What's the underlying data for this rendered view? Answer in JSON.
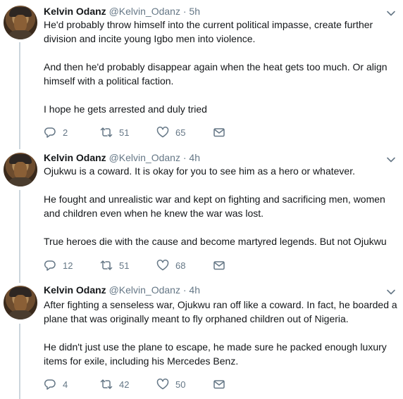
{
  "tweets": [
    {
      "name": "Kelvin Odanz",
      "handle": "@Kelvin_Odanz",
      "time": "· 5h",
      "paragraphs": [
        "He'd probably throw himself into the current political impasse, create further division and incite young Igbo men into violence.",
        "And then he'd probably disappear again when the heat gets too much. Or align himself with a political faction.",
        "I hope he gets arrested and duly tried"
      ],
      "replies": "2",
      "retweets": "51",
      "likes": "65"
    },
    {
      "name": "Kelvin Odanz",
      "handle": "@Kelvin_Odanz",
      "time": "· 4h",
      "paragraphs": [
        "Ojukwu is a coward. It is okay for you to see him as a hero or whatever.",
        "He fought and unrealistic war and kept on fighting and sacrificing men, women and children even when he knew the war was lost.",
        "True heroes die with the cause and become martyred legends. But not Ojukwu"
      ],
      "replies": "12",
      "retweets": "51",
      "likes": "68"
    },
    {
      "name": "Kelvin Odanz",
      "handle": "@Kelvin_Odanz",
      "time": "· 4h",
      "paragraphs": [
        "After fighting a senseless war, Ojukwu ran off like a coward. In fact, he boarded a plane that was originally meant to fly orphaned children out of Nigeria.",
        "He didn't just use the plane to escape, he made sure he packed enough luxury items for exile, including his Mercedes Benz."
      ],
      "replies": "4",
      "retweets": "42",
      "likes": "50"
    }
  ],
  "icons": {
    "reply": "reply-icon",
    "retweet": "retweet-icon",
    "like": "heart-icon",
    "dm": "envelope-icon",
    "more": "chevron-down-icon"
  },
  "colors": {
    "text": "#14171a",
    "muted": "#657786",
    "rail": "#ccd6dd"
  }
}
